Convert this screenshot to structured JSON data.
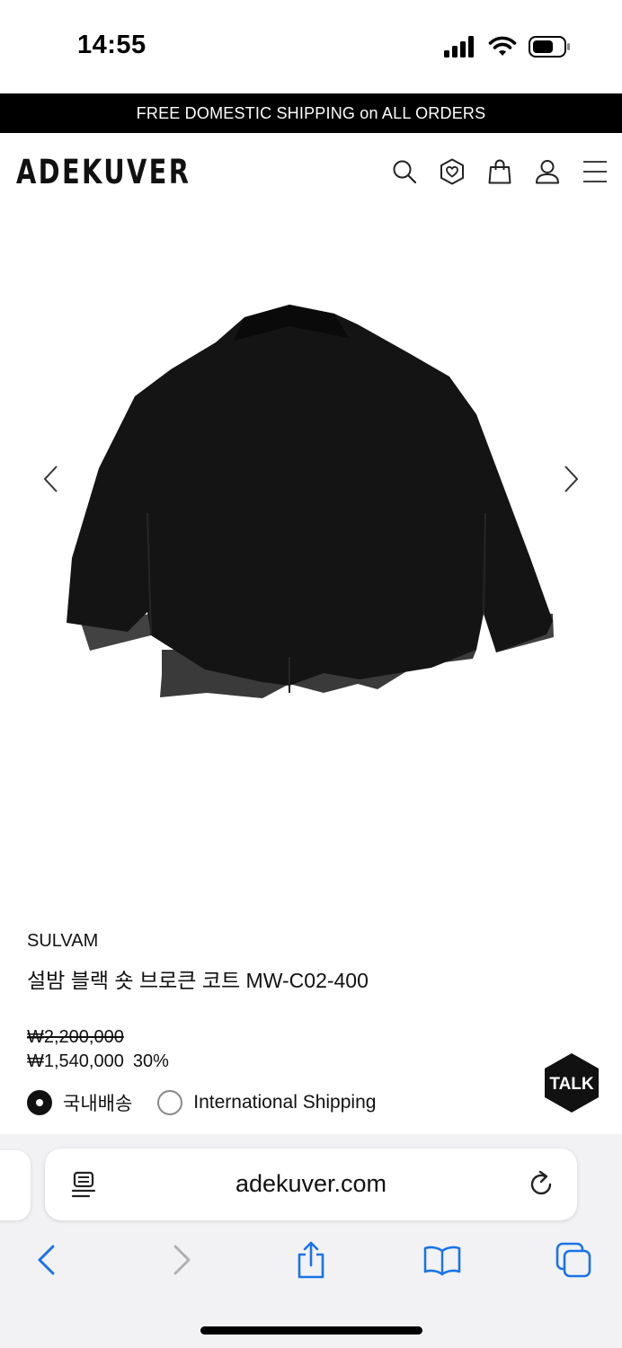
{
  "status_bar": {
    "time": "14:55"
  },
  "promo": {
    "text": "FREE DOMESTIC SHIPPING on ALL ORDERS"
  },
  "header": {
    "logo": "ADEKUVER",
    "icons": [
      "search-icon",
      "wishlist-heart-icon",
      "shopping-bag-icon",
      "account-icon",
      "menu-icon"
    ]
  },
  "product": {
    "brand": "SULVAM",
    "name": "설밤 블랙 숏 브로큰 코트 MW-C02-400",
    "original_price": "₩2,200,000",
    "sale_price": "₩1,540,000",
    "discount": "30%"
  },
  "shipping": {
    "options": [
      {
        "label": "국내배송",
        "selected": true
      },
      {
        "label": "International Shipping",
        "selected": false
      }
    ]
  },
  "talk_button": {
    "label": "TALK"
  },
  "browser": {
    "url": "adekuver.com",
    "toolbar": [
      "back-icon",
      "forward-icon",
      "share-icon",
      "bookmarks-icon",
      "tabs-icon"
    ]
  }
}
